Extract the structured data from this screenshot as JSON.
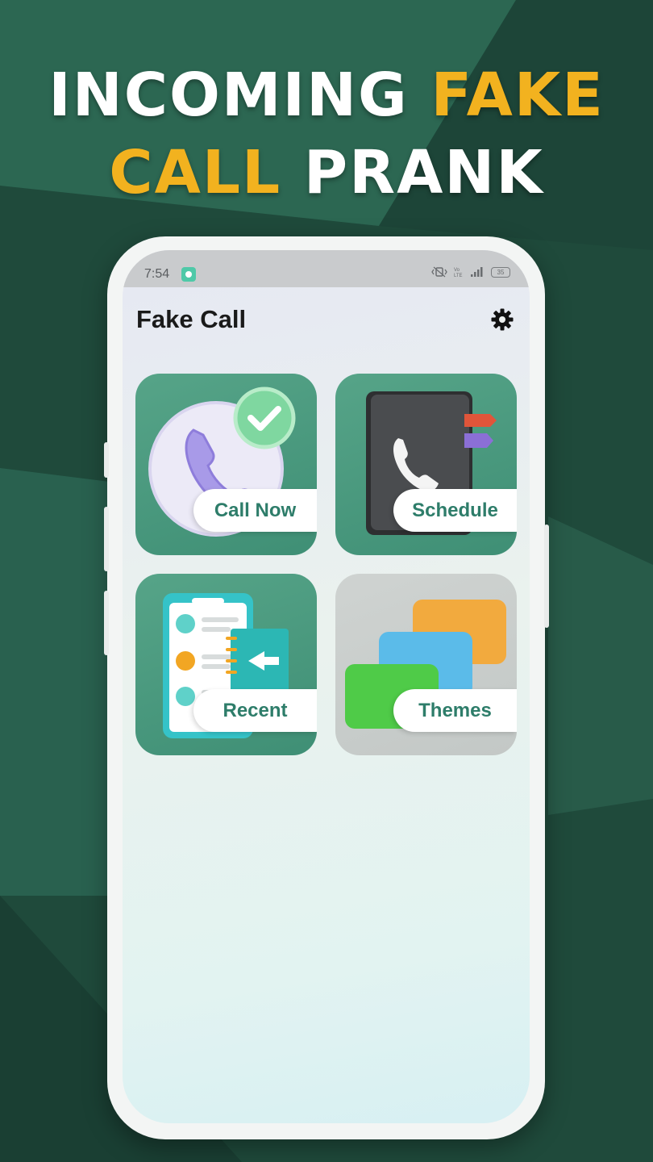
{
  "headline": {
    "part1": "INCOMING ",
    "part2": "FAKE",
    "part3": "CALL",
    "part4": " PRANK"
  },
  "status_bar": {
    "time": "7:54",
    "battery": "35"
  },
  "app": {
    "title": "Fake Call",
    "settings_icon": "gear-icon"
  },
  "tiles": [
    {
      "label": "Call Now",
      "icon": "phone-check-icon"
    },
    {
      "label": "Schedule",
      "icon": "phone-book-icon"
    },
    {
      "label": "Recent",
      "icon": "recent-calls-icon"
    },
    {
      "label": "Themes",
      "icon": "themes-stack-icon"
    }
  ],
  "colors": {
    "accent": "#f2b21f",
    "primary_green": "#3f8f75",
    "label_green": "#2e7d6a",
    "background": "#1f4a3b"
  }
}
